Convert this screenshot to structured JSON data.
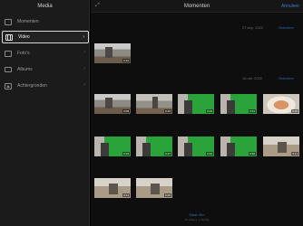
{
  "sidebar": {
    "title": "Media",
    "items": [
      {
        "label": "Momenten",
        "icon": "moments-icon"
      },
      {
        "label": "Video",
        "icon": "film-icon",
        "active": true
      },
      {
        "label": "Foto's",
        "icon": "photos-icon"
      },
      {
        "label": "Albums",
        "icon": "albums-icon"
      },
      {
        "label": "Achtergronden",
        "icon": "backgrounds-icon"
      }
    ]
  },
  "header": {
    "title": "Momenten",
    "cancel_label": "Annuleer"
  },
  "groups": [
    {
      "date": "27 sep. 2022",
      "select_label": "Selecteer",
      "durations": [
        "0:12"
      ]
    },
    {
      "date": "18 okt. 2022",
      "select_label": "Selecteer",
      "durations": [
        "0:08",
        "0:15",
        "0:23",
        "0:31",
        "0:05",
        "0:19",
        "0:27",
        "0:42",
        "0:36",
        "0:11",
        "0:14",
        "0:09"
      ]
    }
  ],
  "footer": {
    "link_label": "Maak film",
    "sub_label": "13 video's, 1 filmstijl"
  },
  "colors": {
    "accent": "#2e6aa9",
    "green_screen": "#2aa33a"
  }
}
